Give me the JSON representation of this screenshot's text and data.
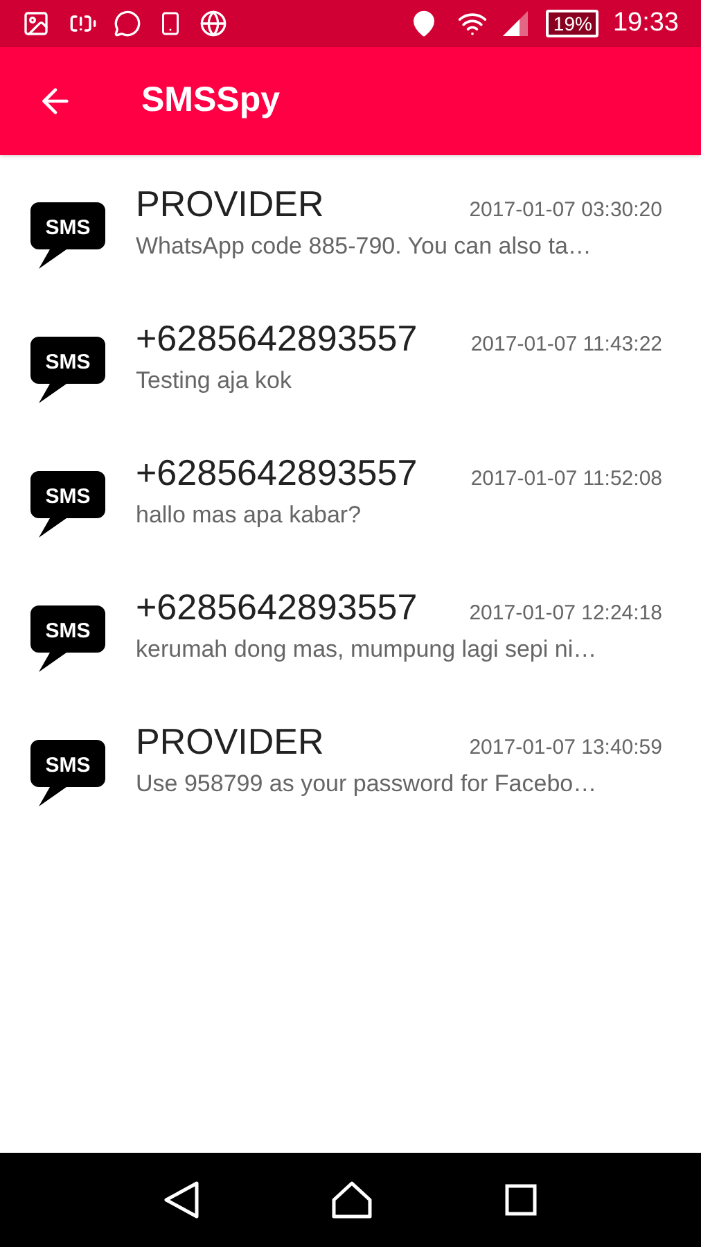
{
  "status_bar": {
    "battery": "19%",
    "time": "19:33"
  },
  "toolbar": {
    "title": "SMSSpy"
  },
  "messages": [
    {
      "icon_label": "SMS",
      "sender": "PROVIDER",
      "time": "2017-01-07 03:30:20",
      "preview": "WhatsApp code 885-790.  You can also ta…"
    },
    {
      "icon_label": "SMS",
      "sender": "+6285642893557",
      "time": "2017-01-07 11:43:22",
      "preview": "Testing aja kok"
    },
    {
      "icon_label": "SMS",
      "sender": "+6285642893557",
      "time": "2017-01-07 11:52:08",
      "preview": "hallo mas apa kabar?"
    },
    {
      "icon_label": "SMS",
      "sender": "+6285642893557",
      "time": "2017-01-07 12:24:18",
      "preview": "kerumah dong mas, mumpung lagi sepi ni…"
    },
    {
      "icon_label": "SMS",
      "sender": "PROVIDER",
      "time": "2017-01-07 13:40:59",
      "preview": "Use 958799 as your password for Facebo…"
    }
  ]
}
